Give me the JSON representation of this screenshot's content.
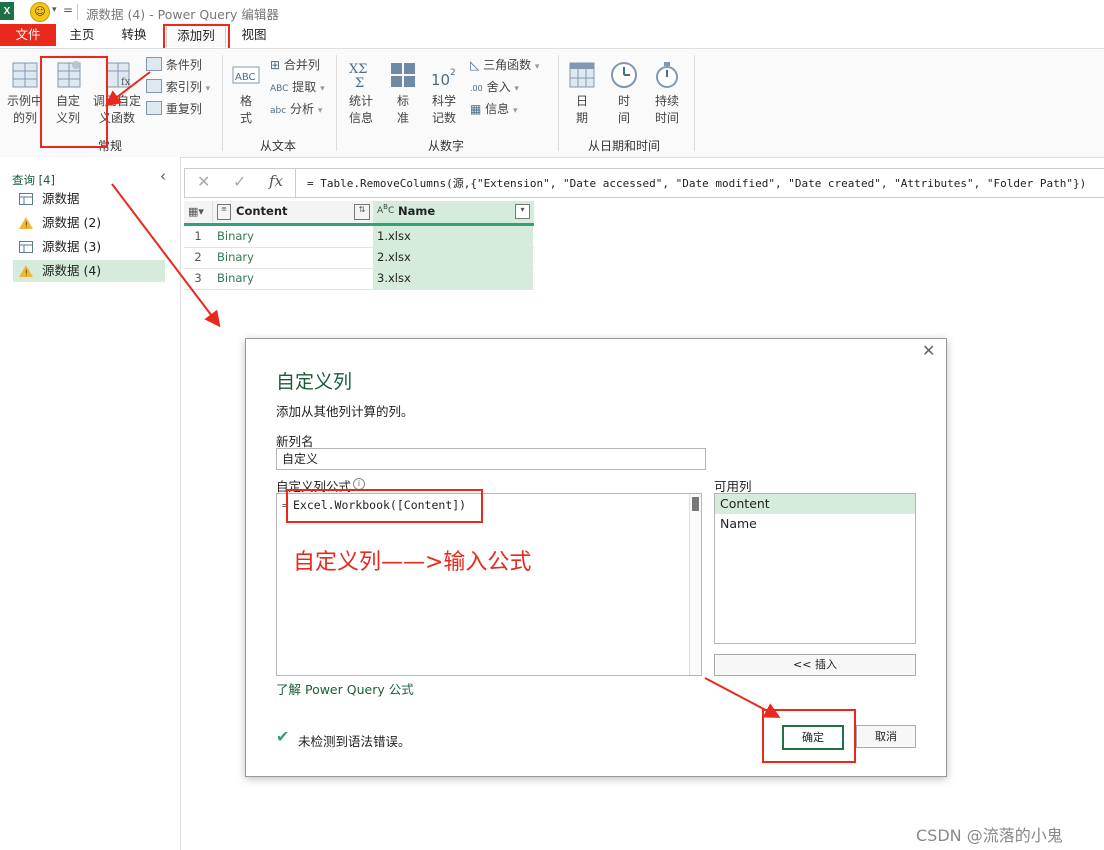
{
  "titlebar": {
    "logo": "X",
    "title": "源数据 (4) - Power Query 编辑器",
    "excel_icon": "excel-icon",
    "smiley_icon": "smiley-icon"
  },
  "tabs": [
    {
      "label": "文件"
    },
    {
      "label": "主页"
    },
    {
      "label": "转换"
    },
    {
      "label": "添加列"
    },
    {
      "label": "视图"
    }
  ],
  "ribbon": {
    "general": {
      "label": "常规",
      "example_column": [
        "示例中",
        "的列"
      ],
      "custom_column": [
        "自定",
        "义列"
      ],
      "invoke_function": [
        "调用自定",
        "义函数"
      ],
      "conditional_column": "条件列",
      "index_column": "索引列",
      "duplicate_column": "重复列"
    },
    "from_text": {
      "label": "从文本",
      "format": [
        "格",
        "式"
      ],
      "merge_columns": "合并列",
      "extract": "提取",
      "parse": "分析"
    },
    "from_number": {
      "label": "从数字",
      "statistics": [
        "统计",
        "信息"
      ],
      "standard": [
        "标",
        "准"
      ],
      "scientific": [
        "科学",
        "记数"
      ],
      "trigonometry": "三角函数",
      "rounding": "舍入",
      "information": "信息"
    },
    "from_datetime": {
      "label": "从日期和时间",
      "date": [
        "日",
        "期"
      ],
      "time": [
        "时",
        "间"
      ],
      "duration": [
        "持续",
        "时间"
      ]
    }
  },
  "queries": {
    "header": "查询 [4]",
    "items": [
      {
        "label": "源数据",
        "icon": "table-icon"
      },
      {
        "label": "源数据 (2)",
        "icon": "warning-icon"
      },
      {
        "label": "源数据 (3)",
        "icon": "table-icon"
      },
      {
        "label": "源数据 (4)",
        "icon": "warning-icon",
        "selected": true
      }
    ]
  },
  "formula_bar": {
    "fx": "fx",
    "formula": "= Table.RemoveColumns(源,{\"Extension\", \"Date accessed\", \"Date modified\", \"Date created\", \"Attributes\", \"Folder Path\"})"
  },
  "grid": {
    "columns": [
      {
        "name": "Content",
        "type_icon": "binary-icon"
      },
      {
        "name": "Name",
        "type_icon": "text-type-icon"
      }
    ],
    "rows": [
      {
        "n": "1",
        "content": "Binary",
        "name": "1.xlsx"
      },
      {
        "n": "2",
        "content": "Binary",
        "name": "2.xlsx"
      },
      {
        "n": "3",
        "content": "Binary",
        "name": "3.xlsx"
      }
    ]
  },
  "dialog": {
    "title": "自定义列",
    "subtitle": "添加从其他列计算的列。",
    "new_column_label": "新列名",
    "new_column_value": "自定义",
    "formula_label": "自定义列公式",
    "formula_prefix": "=",
    "formula_value": "Excel.Workbook([Content])",
    "annotation": "自定义列——>输入公式",
    "available_columns_label": "可用列",
    "available_columns": [
      "Content",
      "Name"
    ],
    "insert_button": "<< 插入",
    "learn_link": "了解 Power Query 公式",
    "status": "未检测到语法错误。",
    "ok_button": "确定",
    "cancel_button": "取消"
  },
  "watermark": "CSDN @流落的小鬼",
  "colors": {
    "accent_green": "#217346",
    "highlight_red": "#e8291c",
    "selected_row": "#d5ecdc"
  }
}
